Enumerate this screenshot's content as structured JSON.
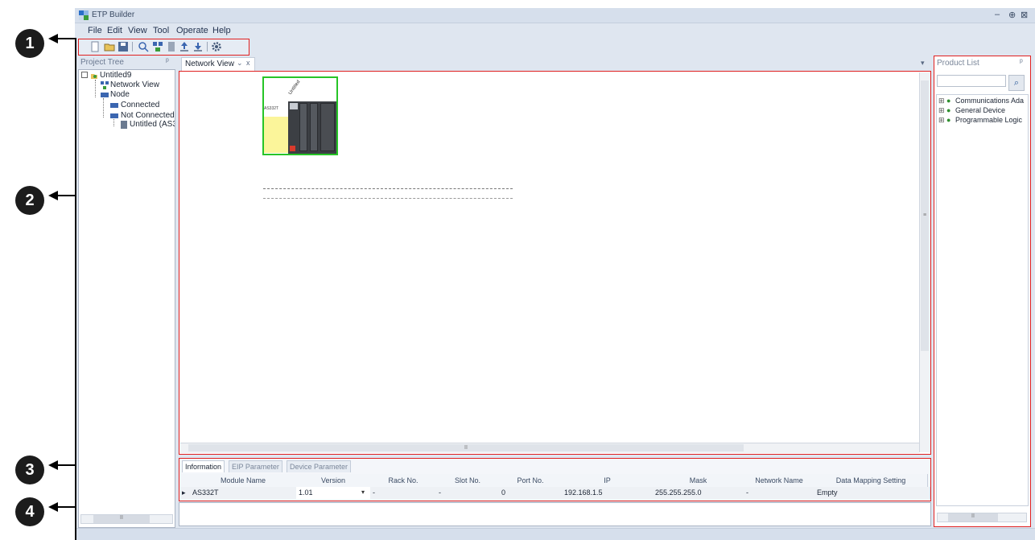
{
  "window": {
    "title": "ETP Builder",
    "min": "–",
    "pin": "⊕",
    "close": "⊠"
  },
  "menu": [
    "File",
    "Edit",
    "View",
    "Tool",
    "Operate",
    "Help"
  ],
  "toolbar": {
    "icons": [
      "new-icon",
      "open-icon",
      "save-icon",
      "scan-icon",
      "network-icon",
      "device-icon",
      "upload-icon",
      "download-icon",
      "settings-icon"
    ]
  },
  "project_tree": {
    "title": "Project Tree",
    "pin": "ᵖ",
    "root": "Untitled9",
    "items": [
      {
        "label": "Network View"
      },
      {
        "label": "Node"
      },
      {
        "label": "Connected"
      },
      {
        "label": "Not Connected"
      },
      {
        "label": "Untitled (AS3"
      }
    ],
    "scroll_glyph": "II"
  },
  "network_view": {
    "tab_label": "Network View",
    "tab_pin": "⌄",
    "tab_close": "x",
    "dropdown": "▾",
    "device_label": "AS332T",
    "device_name": "Untitled",
    "scroll_glyph": "II",
    "vscroll_glyph": "≡"
  },
  "bottom": {
    "tabs": [
      "Information",
      "EIP Parameter",
      "Device Parameter"
    ],
    "columns": [
      "Module Name",
      "Version",
      "Rack No.",
      "Slot No.",
      "Port No.",
      "IP",
      "Mask",
      "Network Name",
      "Data Mapping Setting"
    ],
    "row": [
      "AS332T",
      "1.01",
      "-",
      "-",
      "0",
      "192.168.1.5",
      "255.255.255.0",
      "-",
      "Empty"
    ],
    "row_marker": "▸",
    "dropdown": "▾"
  },
  "product_list": {
    "title": "Product List",
    "pin": "ᵖ",
    "items": [
      "Communications Ada",
      "General Device",
      "Programmable Logic"
    ],
    "search_icon": "⌕",
    "scroll_glyph": "II"
  },
  "callouts": [
    "1",
    "2",
    "3",
    "4"
  ]
}
